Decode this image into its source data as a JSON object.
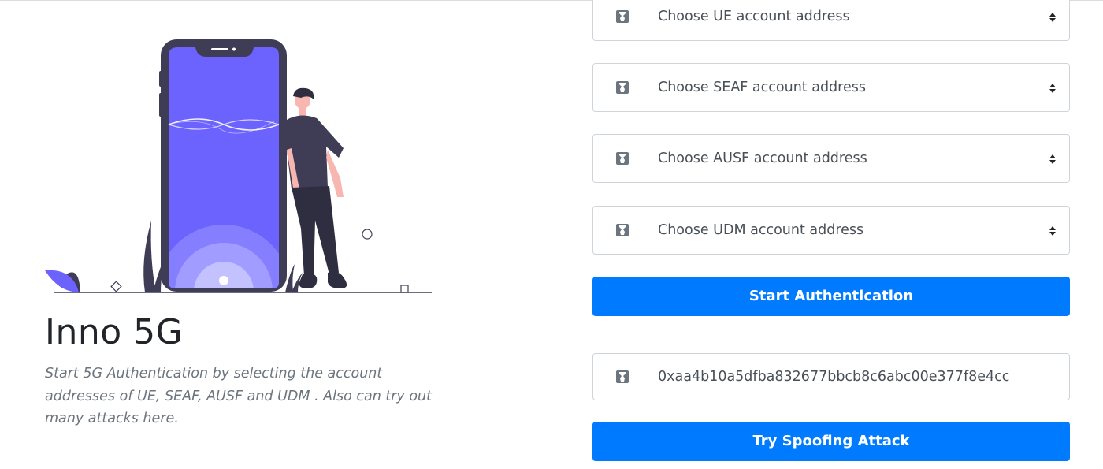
{
  "brand": {
    "title": "Inno 5G",
    "description": "Start 5G Authentication by selecting the account addresses of UE, SEAF, AUSF and UDM . Also can try out many attacks here."
  },
  "selects": [
    {
      "icon": "key-icon",
      "placeholder": "Choose UE account address"
    },
    {
      "icon": "key-icon",
      "placeholder": "Choose SEAF account address"
    },
    {
      "icon": "key-icon",
      "placeholder": "Choose AUSF account address"
    },
    {
      "icon": "key-icon",
      "placeholder": "Choose UDM account address"
    }
  ],
  "actions": {
    "start_label": "Start Authentication",
    "spoof_label": "Try Spoofing Attack"
  },
  "address_input": {
    "icon": "key-icon",
    "value": "0xaa4b10a5dfba832677bbcb8c6abc00e377f8e4cc"
  },
  "colors": {
    "primary": "#007bff",
    "illustration_accent": "#6c63ff",
    "dark": "#3f3d56"
  }
}
